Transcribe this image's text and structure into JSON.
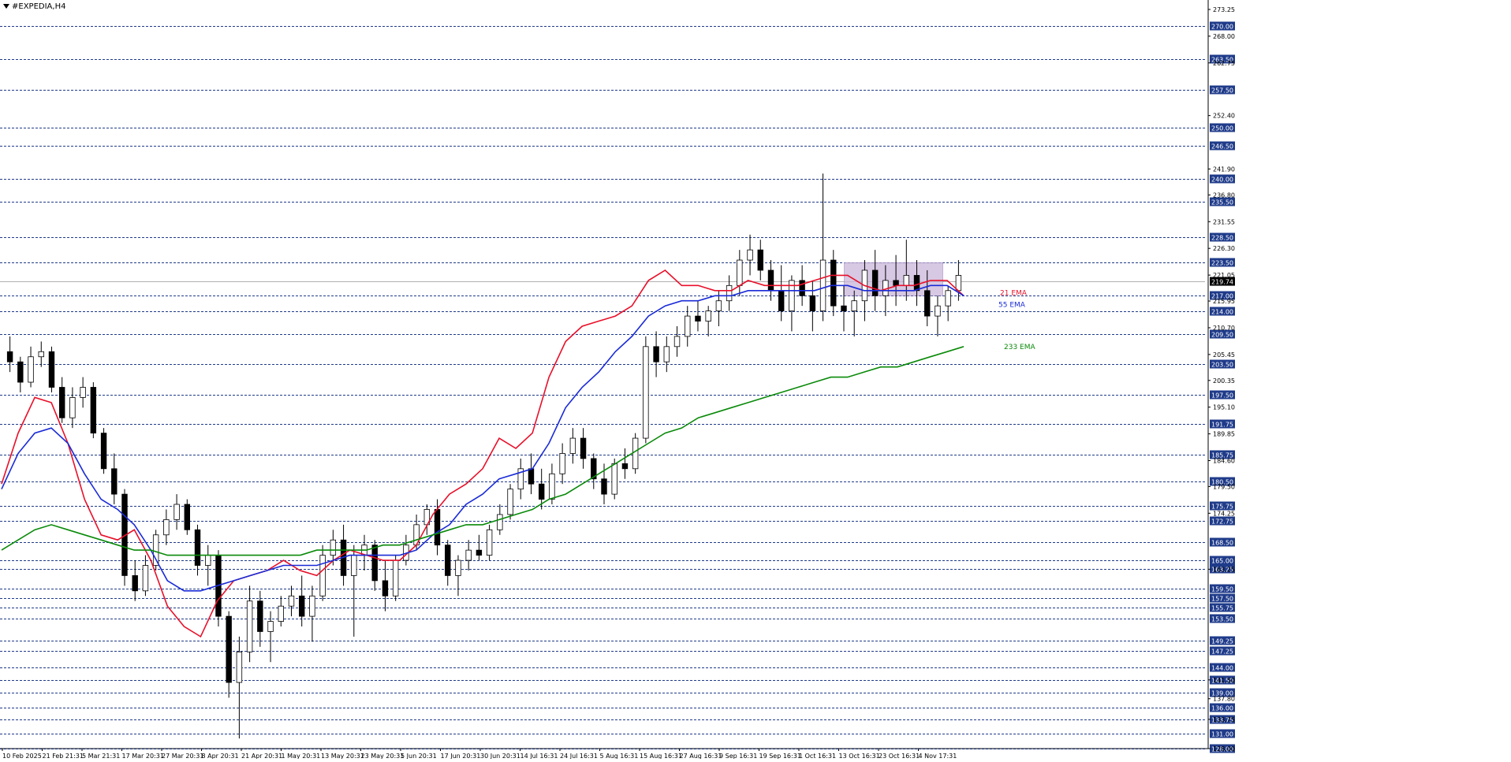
{
  "window": {
    "title": "#EXPEDIA,H4"
  },
  "colors": {
    "background": "#ffffff",
    "hline": "#1f3b8a",
    "price_label_bg": "#1f3b8a",
    "candle": "#000000",
    "ema21": "#e8102a",
    "ema55": "#1a2bd6",
    "ema233": "#0a8a0a",
    "zone": "#c9b6d9"
  },
  "chart_data": {
    "type": "candlestick",
    "symbol": "#EXPEDIA",
    "timeframe": "H4",
    "ylim": [
      128.0,
      273.25
    ],
    "current_price": "219.74",
    "x_tick_labels": [
      "10 Feb 2025",
      "21 Feb 21:31",
      "5 Mar 21:31",
      "17 Mar 20:31",
      "27 Mar 20:31",
      "8 Apr 20:31",
      "21 Apr 20:31",
      "1 May 20:31",
      "13 May 20:31",
      "23 May 20:31",
      "5 Jun 20:31",
      "17 Jun 20:31",
      "30 Jun 20:31",
      "14 Jul 16:31",
      "24 Jul 16:31",
      "5 Aug 16:31",
      "15 Aug 16:31",
      "27 Aug 16:31",
      "9 Sep 16:31",
      "19 Sep 16:31",
      "1 Oct 16:31",
      "13 Oct 16:31",
      "23 Oct 16:31",
      "4 Nov 17:31"
    ],
    "y_tick_labels": [
      "273.25",
      "268.00",
      "262.75",
      "252.40",
      "241.90",
      "236.80",
      "231.55",
      "226.30",
      "221.05",
      "215.95",
      "210.70",
      "205.45",
      "200.35",
      "195.10",
      "189.85",
      "184.60",
      "179.50",
      "174.25",
      "163.25",
      "141.50",
      "137.80",
      "133.75",
      "128.00"
    ],
    "horizontal_levels": [
      "270.00",
      "263.50",
      "257.50",
      "250.00",
      "246.50",
      "240.00",
      "235.50",
      "228.50",
      "223.50",
      "217.00",
      "214.00",
      "209.50",
      "203.50",
      "197.50",
      "191.75",
      "185.75",
      "180.50",
      "175.75",
      "172.75",
      "168.50",
      "165.00",
      "163.25",
      "159.50",
      "157.50",
      "155.75",
      "153.50",
      "149.25",
      "147.25",
      "144.00",
      "141.50",
      "139.00",
      "136.00",
      "133.75",
      "131.00",
      "128.00"
    ],
    "consolidation_zone": {
      "x_start": "13 Oct 16:31",
      "x_end": "4 Nov 17:31",
      "y_low": 217.0,
      "y_high": 223.5
    },
    "series": [
      {
        "name": "21 EMA",
        "color": "#e8102a",
        "x": [
          0,
          8,
          16,
          24,
          32,
          40,
          48,
          56,
          64,
          72,
          80,
          88,
          96,
          104,
          112,
          120,
          128,
          136,
          144,
          152,
          160,
          168,
          176,
          184,
          192,
          200,
          208,
          216,
          224,
          232,
          240,
          248,
          256,
          264,
          272,
          280,
          288,
          296,
          304,
          312,
          320,
          328,
          336,
          344,
          352,
          360,
          368,
          376,
          384,
          392,
          400,
          408,
          416,
          424,
          432,
          440,
          448,
          456,
          464
        ],
        "values": [
          180,
          190,
          197,
          196,
          188,
          177,
          170,
          169,
          171,
          165,
          156,
          152,
          150,
          157,
          161,
          162,
          163,
          165,
          163,
          162,
          165,
          167,
          166,
          165,
          165,
          168,
          174,
          178,
          180,
          183,
          189,
          187,
          190,
          201,
          208,
          211,
          212,
          213,
          215,
          220,
          222,
          219,
          219,
          218,
          218,
          220,
          219,
          219,
          219,
          220,
          221,
          221,
          219,
          218,
          219,
          219,
          220,
          220,
          217
        ]
      },
      {
        "name": "55 EMA",
        "color": "#1a2bd6",
        "x": [
          0,
          8,
          16,
          24,
          32,
          40,
          48,
          56,
          64,
          72,
          80,
          88,
          96,
          104,
          112,
          120,
          128,
          136,
          144,
          152,
          160,
          168,
          176,
          184,
          192,
          200,
          208,
          216,
          224,
          232,
          240,
          248,
          256,
          264,
          272,
          280,
          288,
          296,
          304,
          312,
          320,
          328,
          336,
          344,
          352,
          360,
          368,
          376,
          384,
          392,
          400,
          408,
          416,
          424,
          432,
          440,
          448,
          456,
          464
        ],
        "values": [
          179,
          186,
          190,
          191,
          188,
          182,
          177,
          175,
          172,
          167,
          161,
          159,
          159,
          160,
          161,
          162,
          163,
          164,
          164,
          164,
          165,
          166,
          166,
          166,
          166,
          167,
          170,
          172,
          176,
          178,
          181,
          182,
          183,
          188,
          195,
          199,
          202,
          206,
          209,
          213,
          215,
          216,
          216,
          217,
          217,
          218,
          218,
          218,
          218,
          218,
          219,
          219,
          218,
          218,
          218,
          218,
          219,
          219,
          217
        ]
      },
      {
        "name": "233 EMA",
        "color": "#0a8a0a",
        "x": [
          0,
          8,
          16,
          24,
          32,
          40,
          48,
          56,
          64,
          72,
          80,
          88,
          96,
          104,
          112,
          120,
          128,
          136,
          144,
          152,
          160,
          168,
          176,
          184,
          192,
          200,
          208,
          216,
          224,
          232,
          240,
          248,
          256,
          264,
          272,
          280,
          288,
          296,
          304,
          312,
          320,
          328,
          336,
          344,
          352,
          360,
          368,
          376,
          384,
          392,
          400,
          408,
          416,
          424,
          432,
          440,
          448,
          456,
          464
        ],
        "values": [
          167,
          169,
          171,
          172,
          171,
          170,
          169,
          168,
          167,
          167,
          166,
          166,
          166,
          166,
          166,
          166,
          166,
          166,
          166,
          167,
          167,
          167,
          167,
          168,
          168,
          169,
          170,
          171,
          172,
          172,
          173,
          174,
          175,
          177,
          178,
          180,
          182,
          184,
          186,
          188,
          190,
          191,
          193,
          194,
          195,
          196,
          197,
          198,
          199,
          200,
          201,
          201,
          202,
          203,
          203,
          204,
          205,
          206,
          207
        ]
      }
    ],
    "ohlc": [
      [
        206,
        209,
        202,
        204
      ],
      [
        204,
        205,
        198,
        200
      ],
      [
        200,
        207,
        199,
        205
      ],
      [
        205,
        208,
        203,
        206
      ],
      [
        206,
        207,
        198,
        199
      ],
      [
        199,
        201,
        192,
        193
      ],
      [
        193,
        199,
        191,
        197
      ],
      [
        197,
        201,
        195,
        199
      ],
      [
        199,
        200,
        189,
        190
      ],
      [
        190,
        191,
        182,
        183
      ],
      [
        183,
        186,
        176,
        178
      ],
      [
        178,
        179,
        160,
        162
      ],
      [
        162,
        165,
        157,
        159
      ],
      [
        159,
        166,
        158,
        164
      ],
      [
        164,
        171,
        163,
        170
      ],
      [
        170,
        175,
        168,
        173
      ],
      [
        173,
        178,
        171,
        176
      ],
      [
        176,
        177,
        170,
        171
      ],
      [
        171,
        172,
        162,
        164
      ],
      [
        164,
        168,
        160,
        166
      ],
      [
        166,
        167,
        152,
        154
      ],
      [
        154,
        155,
        138,
        141
      ],
      [
        141,
        150,
        130,
        147
      ],
      [
        147,
        160,
        145,
        157
      ],
      [
        157,
        159,
        148,
        151
      ],
      [
        151,
        155,
        145,
        153
      ],
      [
        153,
        158,
        152,
        156
      ],
      [
        156,
        160,
        154,
        158
      ],
      [
        158,
        162,
        152,
        154
      ],
      [
        154,
        160,
        149,
        158
      ],
      [
        158,
        168,
        157,
        166
      ],
      [
        166,
        171,
        164,
        169
      ],
      [
        169,
        172,
        160,
        162
      ],
      [
        162,
        168,
        150,
        166
      ],
      [
        166,
        170,
        163,
        168
      ],
      [
        168,
        169,
        159,
        161
      ],
      [
        161,
        165,
        155,
        158
      ],
      [
        158,
        166,
        157,
        165
      ],
      [
        165,
        170,
        164,
        168
      ],
      [
        168,
        174,
        167,
        172
      ],
      [
        172,
        176,
        170,
        175
      ],
      [
        175,
        177,
        166,
        168
      ],
      [
        168,
        169,
        160,
        162
      ],
      [
        162,
        166,
        158,
        165
      ],
      [
        165,
        169,
        163,
        167
      ],
      [
        167,
        170,
        165,
        166
      ],
      [
        166,
        172,
        165,
        171
      ],
      [
        171,
        176,
        170,
        174
      ],
      [
        174,
        180,
        173,
        179
      ],
      [
        179,
        185,
        177,
        183
      ],
      [
        183,
        186,
        178,
        180
      ],
      [
        180,
        183,
        175,
        177
      ],
      [
        177,
        184,
        176,
        182
      ],
      [
        182,
        188,
        180,
        186
      ],
      [
        186,
        191,
        184,
        189
      ],
      [
        189,
        191,
        183,
        185
      ],
      [
        185,
        186,
        179,
        181
      ],
      [
        181,
        184,
        176,
        178
      ],
      [
        178,
        185,
        177,
        184
      ],
      [
        184,
        187,
        181,
        183
      ],
      [
        183,
        190,
        182,
        189
      ],
      [
        189,
        209,
        188,
        207
      ],
      [
        207,
        210,
        201,
        204
      ],
      [
        204,
        209,
        202,
        207
      ],
      [
        207,
        211,
        205,
        209
      ],
      [
        209,
        215,
        207,
        213
      ],
      [
        213,
        216,
        210,
        212
      ],
      [
        212,
        215,
        209,
        214
      ],
      [
        214,
        218,
        211,
        216
      ],
      [
        216,
        221,
        214,
        219
      ],
      [
        219,
        226,
        217,
        224
      ],
      [
        224,
        229,
        221,
        226
      ],
      [
        226,
        228,
        220,
        222
      ],
      [
        222,
        224,
        216,
        218
      ],
      [
        218,
        223,
        212,
        214
      ],
      [
        214,
        221,
        210,
        220
      ],
      [
        220,
        223,
        215,
        217
      ],
      [
        217,
        220,
        210,
        214
      ],
      [
        214,
        241,
        212,
        224
      ],
      [
        224,
        226,
        213,
        215
      ],
      [
        215,
        219,
        210,
        214
      ],
      [
        214,
        218,
        209,
        216
      ],
      [
        216,
        224,
        212,
        222
      ],
      [
        222,
        226,
        214,
        217
      ],
      [
        217,
        223,
        213,
        220
      ],
      [
        220,
        225,
        215,
        219
      ],
      [
        219,
        228,
        216,
        221
      ],
      [
        221,
        224,
        215,
        218
      ],
      [
        218,
        222,
        211,
        213
      ],
      [
        213,
        217,
        209,
        215
      ],
      [
        215,
        219,
        212,
        218
      ],
      [
        218,
        224,
        216,
        221
      ]
    ]
  }
}
